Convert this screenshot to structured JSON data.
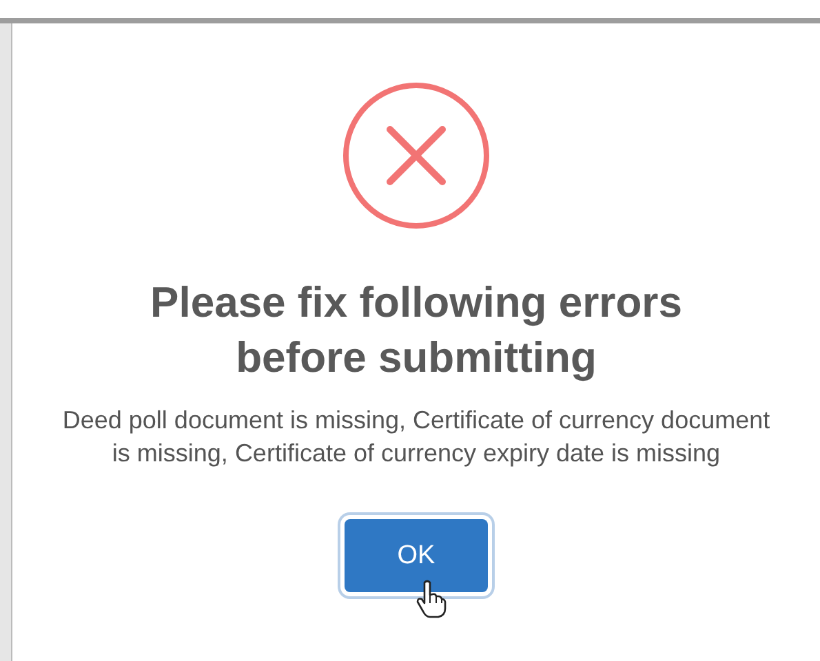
{
  "dialog": {
    "icon": {
      "kind": "error"
    },
    "title": "Please fix following errors before submitting",
    "message": "Deed poll document is missing, Certificate of currency document is missing, Certificate of currency expiry date is missing",
    "confirm_button": "OK"
  }
}
